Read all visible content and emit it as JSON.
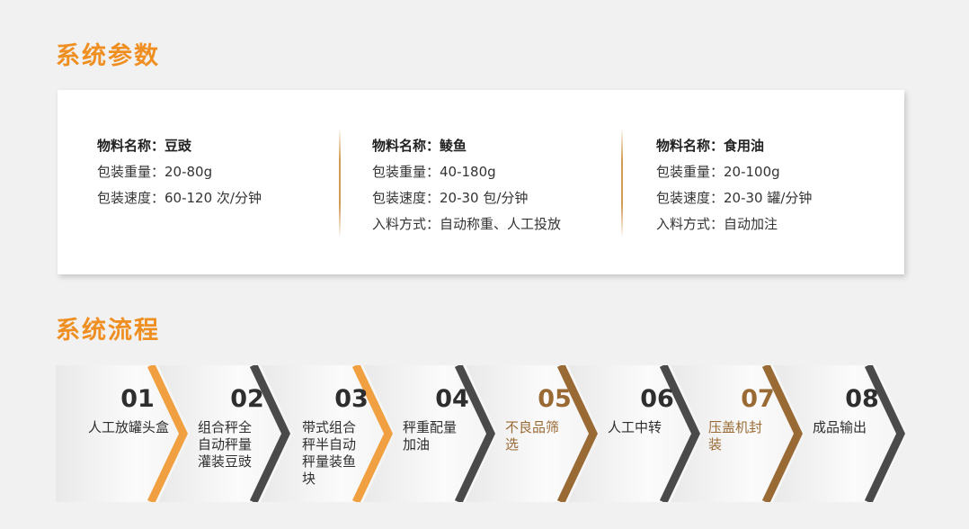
{
  "sections": {
    "params_title": "系统参数",
    "flow_title": "系统流程"
  },
  "params": [
    {
      "material": "物料名称：豆豉",
      "weight": "包装重量：20-80g",
      "speed": "包装速度：60-120 次/分钟",
      "feed": ""
    },
    {
      "material": "物料名称：鲮鱼",
      "weight": "包装重量：40-180g",
      "speed": "包装速度：20-30 包/分钟",
      "feed": "入料方式：自动称重、人工投放"
    },
    {
      "material": "物料名称：食用油",
      "weight": "包装重量：20-100g",
      "speed": "包装速度：20-30 罐/分钟",
      "feed": "入料方式：自动加注"
    }
  ],
  "flow_steps": [
    {
      "num": "01",
      "text": "人工放罐头盒",
      "chevron_color": "#f0a040"
    },
    {
      "num": "02",
      "text": "组合秤全自动秤量灌装豆豉",
      "chevron_color": "#4a4a4a"
    },
    {
      "num": "03",
      "text": "带式组合秤半自动秤量装鱼块",
      "chevron_color": "#f0a040"
    },
    {
      "num": "04",
      "text": "秤重配量加油",
      "chevron_color": "#4a4a4a"
    },
    {
      "num": "05",
      "text": "不良品筛选",
      "chevron_color": "#9a6a35"
    },
    {
      "num": "06",
      "text": "人工中转",
      "chevron_color": "#4a4a4a"
    },
    {
      "num": "07",
      "text": "压盖机封装",
      "chevron_color": "#9a6a35"
    },
    {
      "num": "08",
      "text": "成品输出",
      "chevron_color": "#4a4a4a"
    }
  ],
  "colors": {
    "accent": "#ef8f22",
    "brown": "#9a6a35",
    "dark": "#4a4a4a"
  }
}
